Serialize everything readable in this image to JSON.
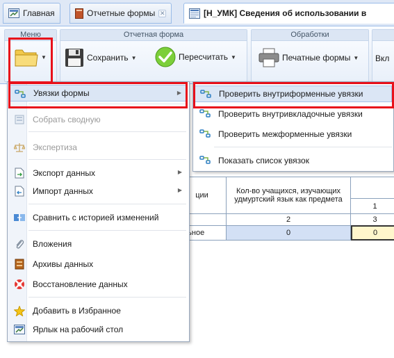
{
  "tabs": [
    {
      "label": "Главная",
      "icon": "home-icon"
    },
    {
      "label": "Отчетные формы",
      "icon": "reports-icon",
      "closable": true
    },
    {
      "label": "[Н_УМК] Сведения об использовании в",
      "icon": "form-icon",
      "active": true
    }
  ],
  "ribbon": {
    "menu_group": {
      "title": "Меню"
    },
    "report_group": {
      "title": "Отчетная форма",
      "save_label": "Сохранить",
      "recalc_label": "Пересчитать"
    },
    "processing_group": {
      "title": "Обработки",
      "print_label": "Печатные формы"
    },
    "cut_label": "Вкл"
  },
  "grid": {
    "header_fragment": "ции",
    "column_header": "Кол-во учащихся, изучающих удмуртский язык как предмета",
    "col_num_1": "1",
    "row_num_a": "2",
    "row_num_b": "3",
    "row_label_fragment": "ельное",
    "value_a": "0",
    "value_b": "0"
  },
  "menu": {
    "items": [
      {
        "label": "Увязки формы",
        "icon": "link-icon",
        "submenu": true,
        "state": "hover"
      },
      {
        "label": "Собрать сводную",
        "icon": "collect-icon",
        "state": "disabled"
      },
      {
        "label": "Экспертиза",
        "icon": "scales-icon",
        "state": "disabled"
      },
      {
        "label": "Экспорт данных",
        "icon": "export-icon",
        "submenu": true
      },
      {
        "label": "Импорт данных",
        "icon": "import-icon",
        "submenu": true
      },
      {
        "label": "Сравнить с историей изменений",
        "icon": "compare-icon"
      },
      {
        "label": "Вложения",
        "icon": "paperclip-icon"
      },
      {
        "label": "Архивы данных",
        "icon": "archive-icon"
      },
      {
        "label": "Восстановление данных",
        "icon": "lifebuoy-icon"
      },
      {
        "label": "Добавить в Избранное",
        "icon": "star-icon"
      },
      {
        "label": "Ярлык на рабочий стол",
        "icon": "shortcut-icon"
      }
    ]
  },
  "submenu": {
    "items": [
      {
        "label": "Проверить внутриформенные увязки",
        "icon": "link-icon",
        "state": "hover"
      },
      {
        "label": "Проверить внутривкладочные увязки",
        "icon": "link-icon"
      },
      {
        "label": "Проверить межформенные увязки",
        "icon": "link-icon"
      },
      {
        "label": "Показать список увязок",
        "icon": "link-icon"
      }
    ]
  },
  "colors": {
    "highlight_red": "#e8101a",
    "hover_bg": "#dbe6f5",
    "accent_blue": "#99bbe8"
  }
}
